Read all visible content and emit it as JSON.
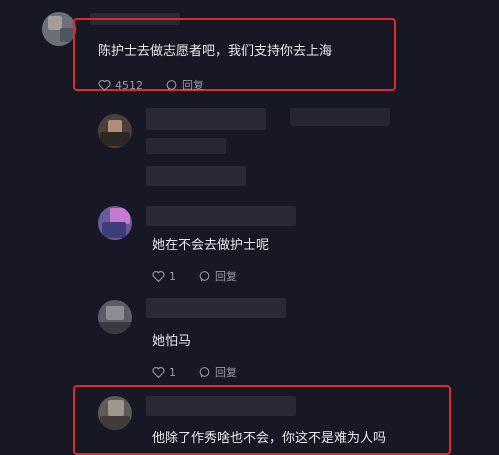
{
  "comments": [
    {
      "text": "陈护士去做志愿者吧，我们支持你去上海",
      "likes": "4512",
      "reply_label": "回复"
    },
    {
      "text": ""
    },
    {
      "text": "她在不会去做护士呢",
      "likes": "1",
      "reply_label": "回复"
    },
    {
      "text": "她怕⻢",
      "likes": "1",
      "reply_label": "回复"
    },
    {
      "text": "他除了作秀啥也不会，你这不是难为人吗"
    }
  ],
  "colors": {
    "background": "#181824",
    "highlight": "#e0282e",
    "muted": "#9a9aa6"
  }
}
